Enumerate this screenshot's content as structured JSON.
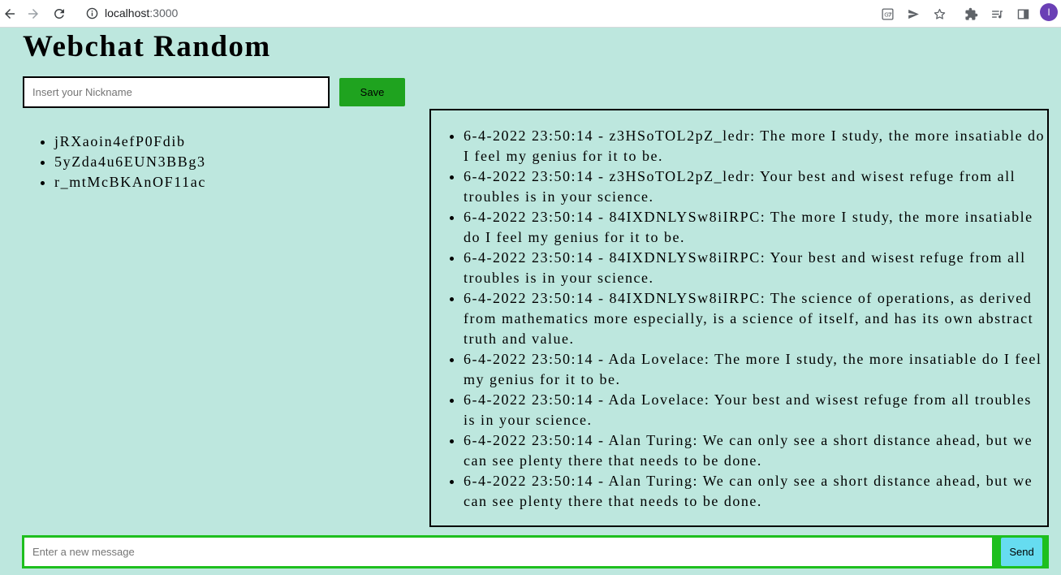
{
  "browser": {
    "url_host": "localhost",
    "url_port": ":3000",
    "avatar_initial": "I",
    "icons": [
      "back-arrow-icon",
      "forward-arrow-icon",
      "reload-icon",
      "info-icon",
      "translate-icon",
      "send-tab-icon",
      "bookmark-star-icon",
      "extensions-icon",
      "reading-list-icon",
      "side-panel-icon"
    ]
  },
  "page": {
    "title": "Webchat Random"
  },
  "nickname": {
    "placeholder": "Insert your Nickname",
    "value": "",
    "save_label": "Save"
  },
  "users": [
    "jRXaoin4efP0Fdib",
    "5yZda4u6EUN3BBg3",
    "r_mtMcBKAnOF11ac"
  ],
  "messages": [
    "6-4-2022 23:50:14 - z3HSoTOL2pZ_ledr: The more I study, the more insatiable do I feel my genius for it to be.",
    "6-4-2022 23:50:14 - z3HSoTOL2pZ_ledr: Your best and wisest refuge from all troubles is in your science.",
    "6-4-2022 23:50:14 - 84IXDNLYSw8iIRPC: The more I study, the more insatiable do I feel my genius for it to be.",
    "6-4-2022 23:50:14 - 84IXDNLYSw8iIRPC: Your best and wisest refuge from all troubles is in your science.",
    "6-4-2022 23:50:14 - 84IXDNLYSw8iIRPC: The science of operations, as derived from mathematics more especially, is a science of itself, and has its own abstract truth and value.",
    "6-4-2022 23:50:14 - Ada Lovelace: The more I study, the more insatiable do I feel my genius for it to be.",
    "6-4-2022 23:50:14 - Ada Lovelace: Your best and wisest refuge from all troubles is in your science.",
    "6-4-2022 23:50:14 - Alan Turing: We can only see a short distance ahead, but we can see plenty there that needs to be done.",
    "6-4-2022 23:50:14 - Alan Turing: We can only see a short distance ahead, but we can see plenty there that needs to be done."
  ],
  "message_form": {
    "placeholder": "Enter a new message",
    "value": "",
    "send_label": "Send"
  },
  "colors": {
    "background": "#bde7de",
    "save_button": "#1fa31f",
    "send_button": "#66dcf0",
    "message_form_border": "#1ebf1e"
  }
}
